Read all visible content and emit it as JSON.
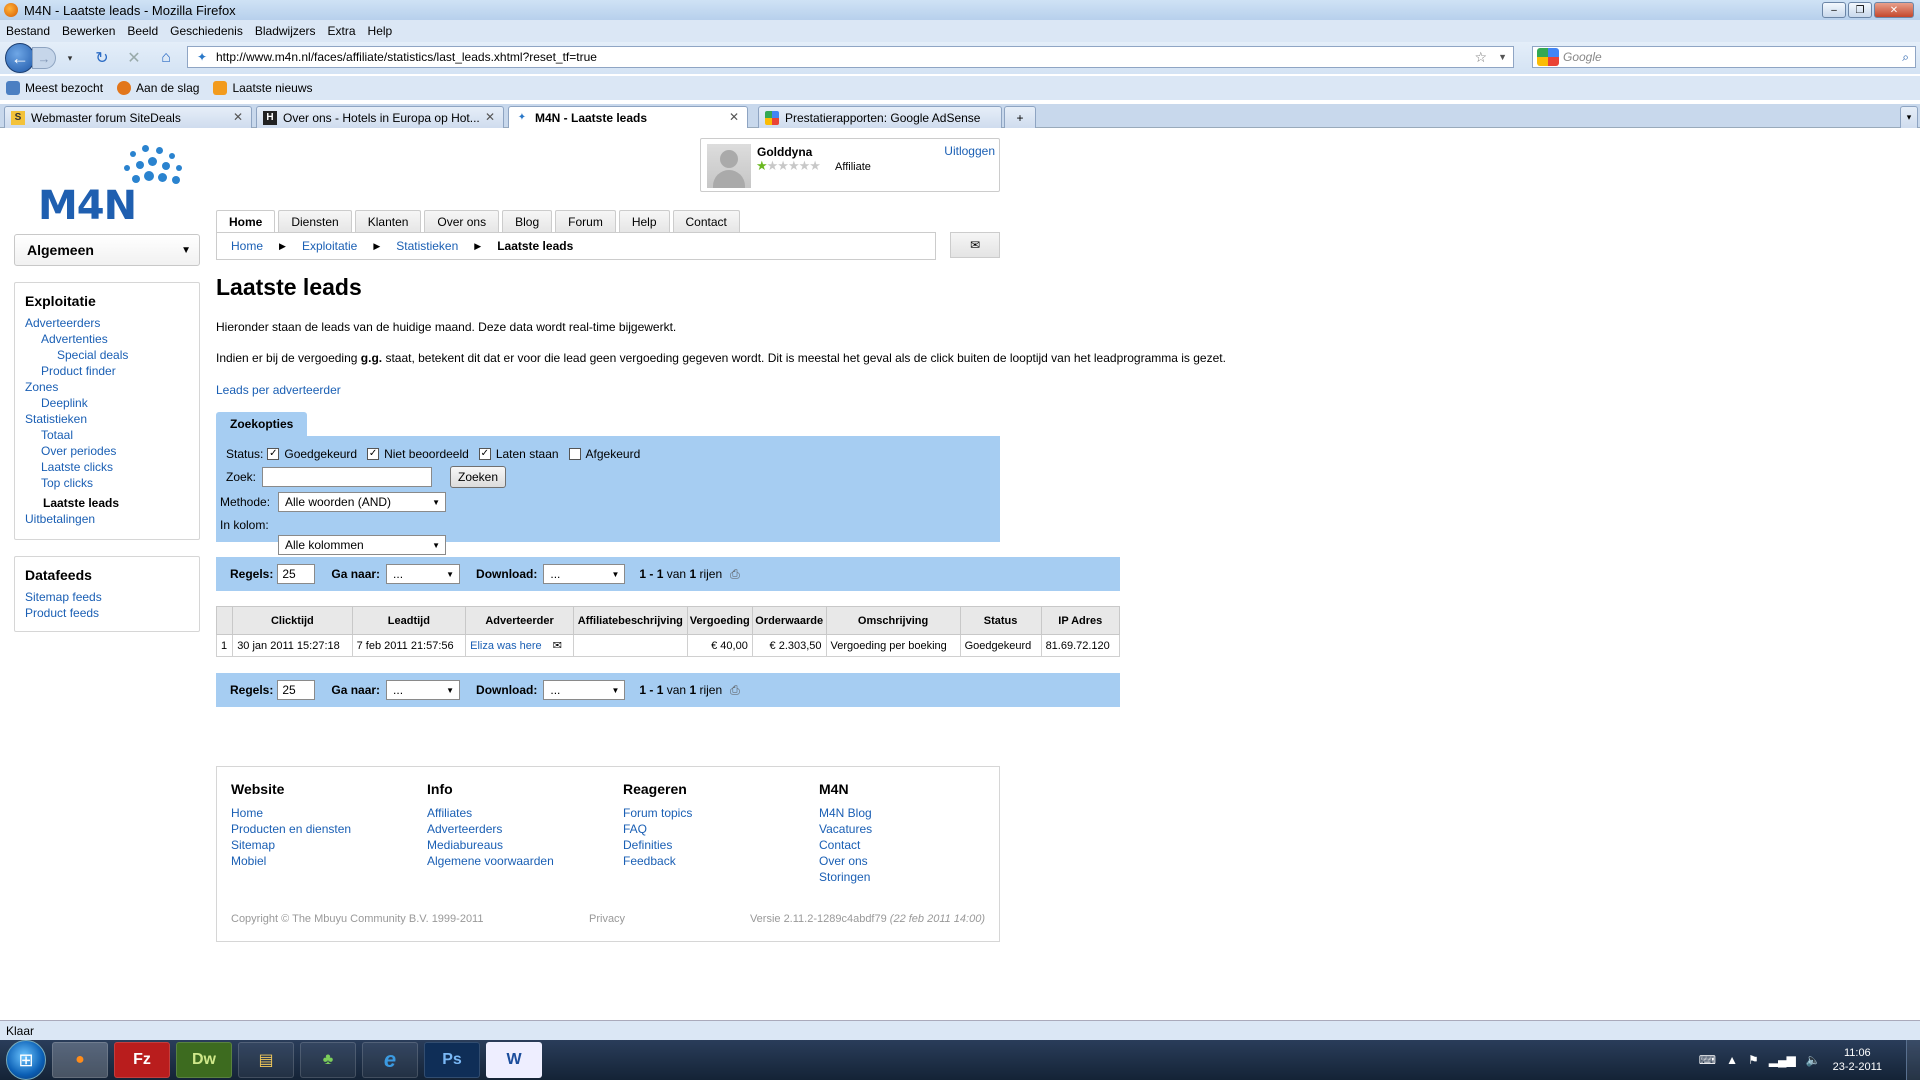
{
  "window": {
    "title": "M4N - Laatste leads - Mozilla Firefox"
  },
  "menu": [
    "Bestand",
    "Bewerken",
    "Beeld",
    "Geschiedenis",
    "Bladwijzers",
    "Extra",
    "Help"
  ],
  "url": "http://www.m4n.nl/faces/affiliate/statistics/last_leads.xhtml?reset_tf=true",
  "search_placeholder": "Google",
  "bookmarks": [
    "Meest bezocht",
    "Aan de slag",
    "Laatste nieuws"
  ],
  "tabs": [
    {
      "label": "Webmaster forum SiteDeals",
      "icon": "SD"
    },
    {
      "label": "Over ons - Hotels in Europa op Hot...",
      "icon": "H"
    },
    {
      "label": "M4N - Laatste leads",
      "icon": "M"
    },
    {
      "label": "Prestatierapporten: Google AdSense",
      "icon": "G"
    }
  ],
  "site": {
    "logo_text": "M4N",
    "user": {
      "name": "Golddyna",
      "role": "Affiliate",
      "logout": "Uitloggen",
      "rating_stars": 5,
      "rating_value": 0.5
    },
    "section_select": "Algemeen",
    "nav": [
      "Home",
      "Diensten",
      "Klanten",
      "Over ons",
      "Blog",
      "Forum",
      "Help",
      "Contact"
    ],
    "breadcrumb": [
      "Home",
      "Exploitatie",
      "Statistieken",
      "Laatste leads"
    ],
    "sidebar": {
      "title": "Exploitatie",
      "items": [
        {
          "label": "Adverteerders",
          "level": 1
        },
        {
          "label": "Advertenties",
          "level": 2
        },
        {
          "label": "Special deals",
          "level": 3
        },
        {
          "label": "Product finder",
          "level": 2
        },
        {
          "label": "Zones",
          "level": 1
        },
        {
          "label": "Deeplink",
          "level": 2
        },
        {
          "label": "Statistieken",
          "level": 1
        },
        {
          "label": "Totaal",
          "level": 2
        },
        {
          "label": "Over periodes",
          "level": 2
        },
        {
          "label": "Laatste clicks",
          "level": 2
        },
        {
          "label": "Top clicks",
          "level": 2
        },
        {
          "label": "Laatste leads",
          "level": 2,
          "current": true
        },
        {
          "label": "Uitbetalingen",
          "level": 1
        }
      ],
      "datafeeds_title": "Datafeeds",
      "datafeeds": [
        "Sitemap feeds",
        "Product feeds"
      ]
    },
    "page_title": "Laatste leads",
    "intro": "Hieronder staan de leads van de huidige maand. Deze data wordt real-time bijgewerkt.",
    "note_before": "Indien er bij de vergoeding ",
    "note_bold": "g.g.",
    "note_after": " staat, betekent dit dat er voor die lead geen vergoeding gegeven wordt. Dit is meestal het geval als de click buiten de looptijd van het leadprogramma is gezet.",
    "leads_link": "Leads per adverteerder",
    "filter": {
      "tab": "Zoekopties",
      "status_label": "Status:",
      "statuses": [
        {
          "label": "Goedgekeurd",
          "checked": true
        },
        {
          "label": "Niet beoordeeld",
          "checked": true
        },
        {
          "label": "Laten staan",
          "checked": true
        },
        {
          "label": "Afgekeurd",
          "checked": false
        }
      ],
      "zoek_label": "Zoek:",
      "zoek_value": "",
      "zoek_button": "Zoeken",
      "methode_label": "Methode:",
      "methode_value": "Alle woorden (AND)",
      "kolom_label": "In kolom:",
      "kolom_value": "Alle kolommen"
    },
    "pager": {
      "regels_label": "Regels:",
      "regels_value": "25",
      "ganaar_label": "Ga naar:",
      "ganaar_value": "...",
      "download_label": "Download:",
      "download_value": "...",
      "range": "1 - 1",
      "van": "van",
      "total": "1",
      "rijen": "rijen"
    },
    "table": {
      "headers": [
        "",
        "Clicktijd",
        "Leadtijd",
        "Adverteerder",
        "Affiliatebeschrijving",
        "Vergoeding",
        "Orderwaarde",
        "Omschrijving",
        "Status",
        "IP Adres"
      ],
      "rows": [
        [
          "1",
          "30 jan 2011 15:27:18",
          "7 feb 2011 21:57:56",
          "Eliza was here",
          "",
          "€ 40,00",
          "€ 2.303,50",
          "Vergoeding per boeking",
          "Goedgekeurd",
          "81.69.72.120"
        ]
      ]
    },
    "footer": {
      "cols": [
        {
          "title": "Website",
          "links": [
            "Home",
            "Producten en diensten",
            "Sitemap",
            "Mobiel"
          ]
        },
        {
          "title": "Info",
          "links": [
            "Affiliates",
            "Adverteerders",
            "Mediabureaus",
            "Algemene voorwaarden"
          ]
        },
        {
          "title": "Reageren",
          "links": [
            "Forum topics",
            "FAQ",
            "Definities",
            "Feedback"
          ]
        },
        {
          "title": "M4N",
          "links": [
            "M4N Blog",
            "Vacatures",
            "Contact",
            "Over ons",
            "Storingen"
          ]
        }
      ],
      "copyright": "Copyright © The Mbuyu Community B.V. 1999-2011",
      "privacy": "Privacy",
      "version": "Versie 2.11.2-1289c4abdf79",
      "version_date": "(22 feb 2011 14:00)"
    }
  },
  "status": "Klaar",
  "clock": {
    "time": "11:06",
    "date": "23-2-2011"
  }
}
